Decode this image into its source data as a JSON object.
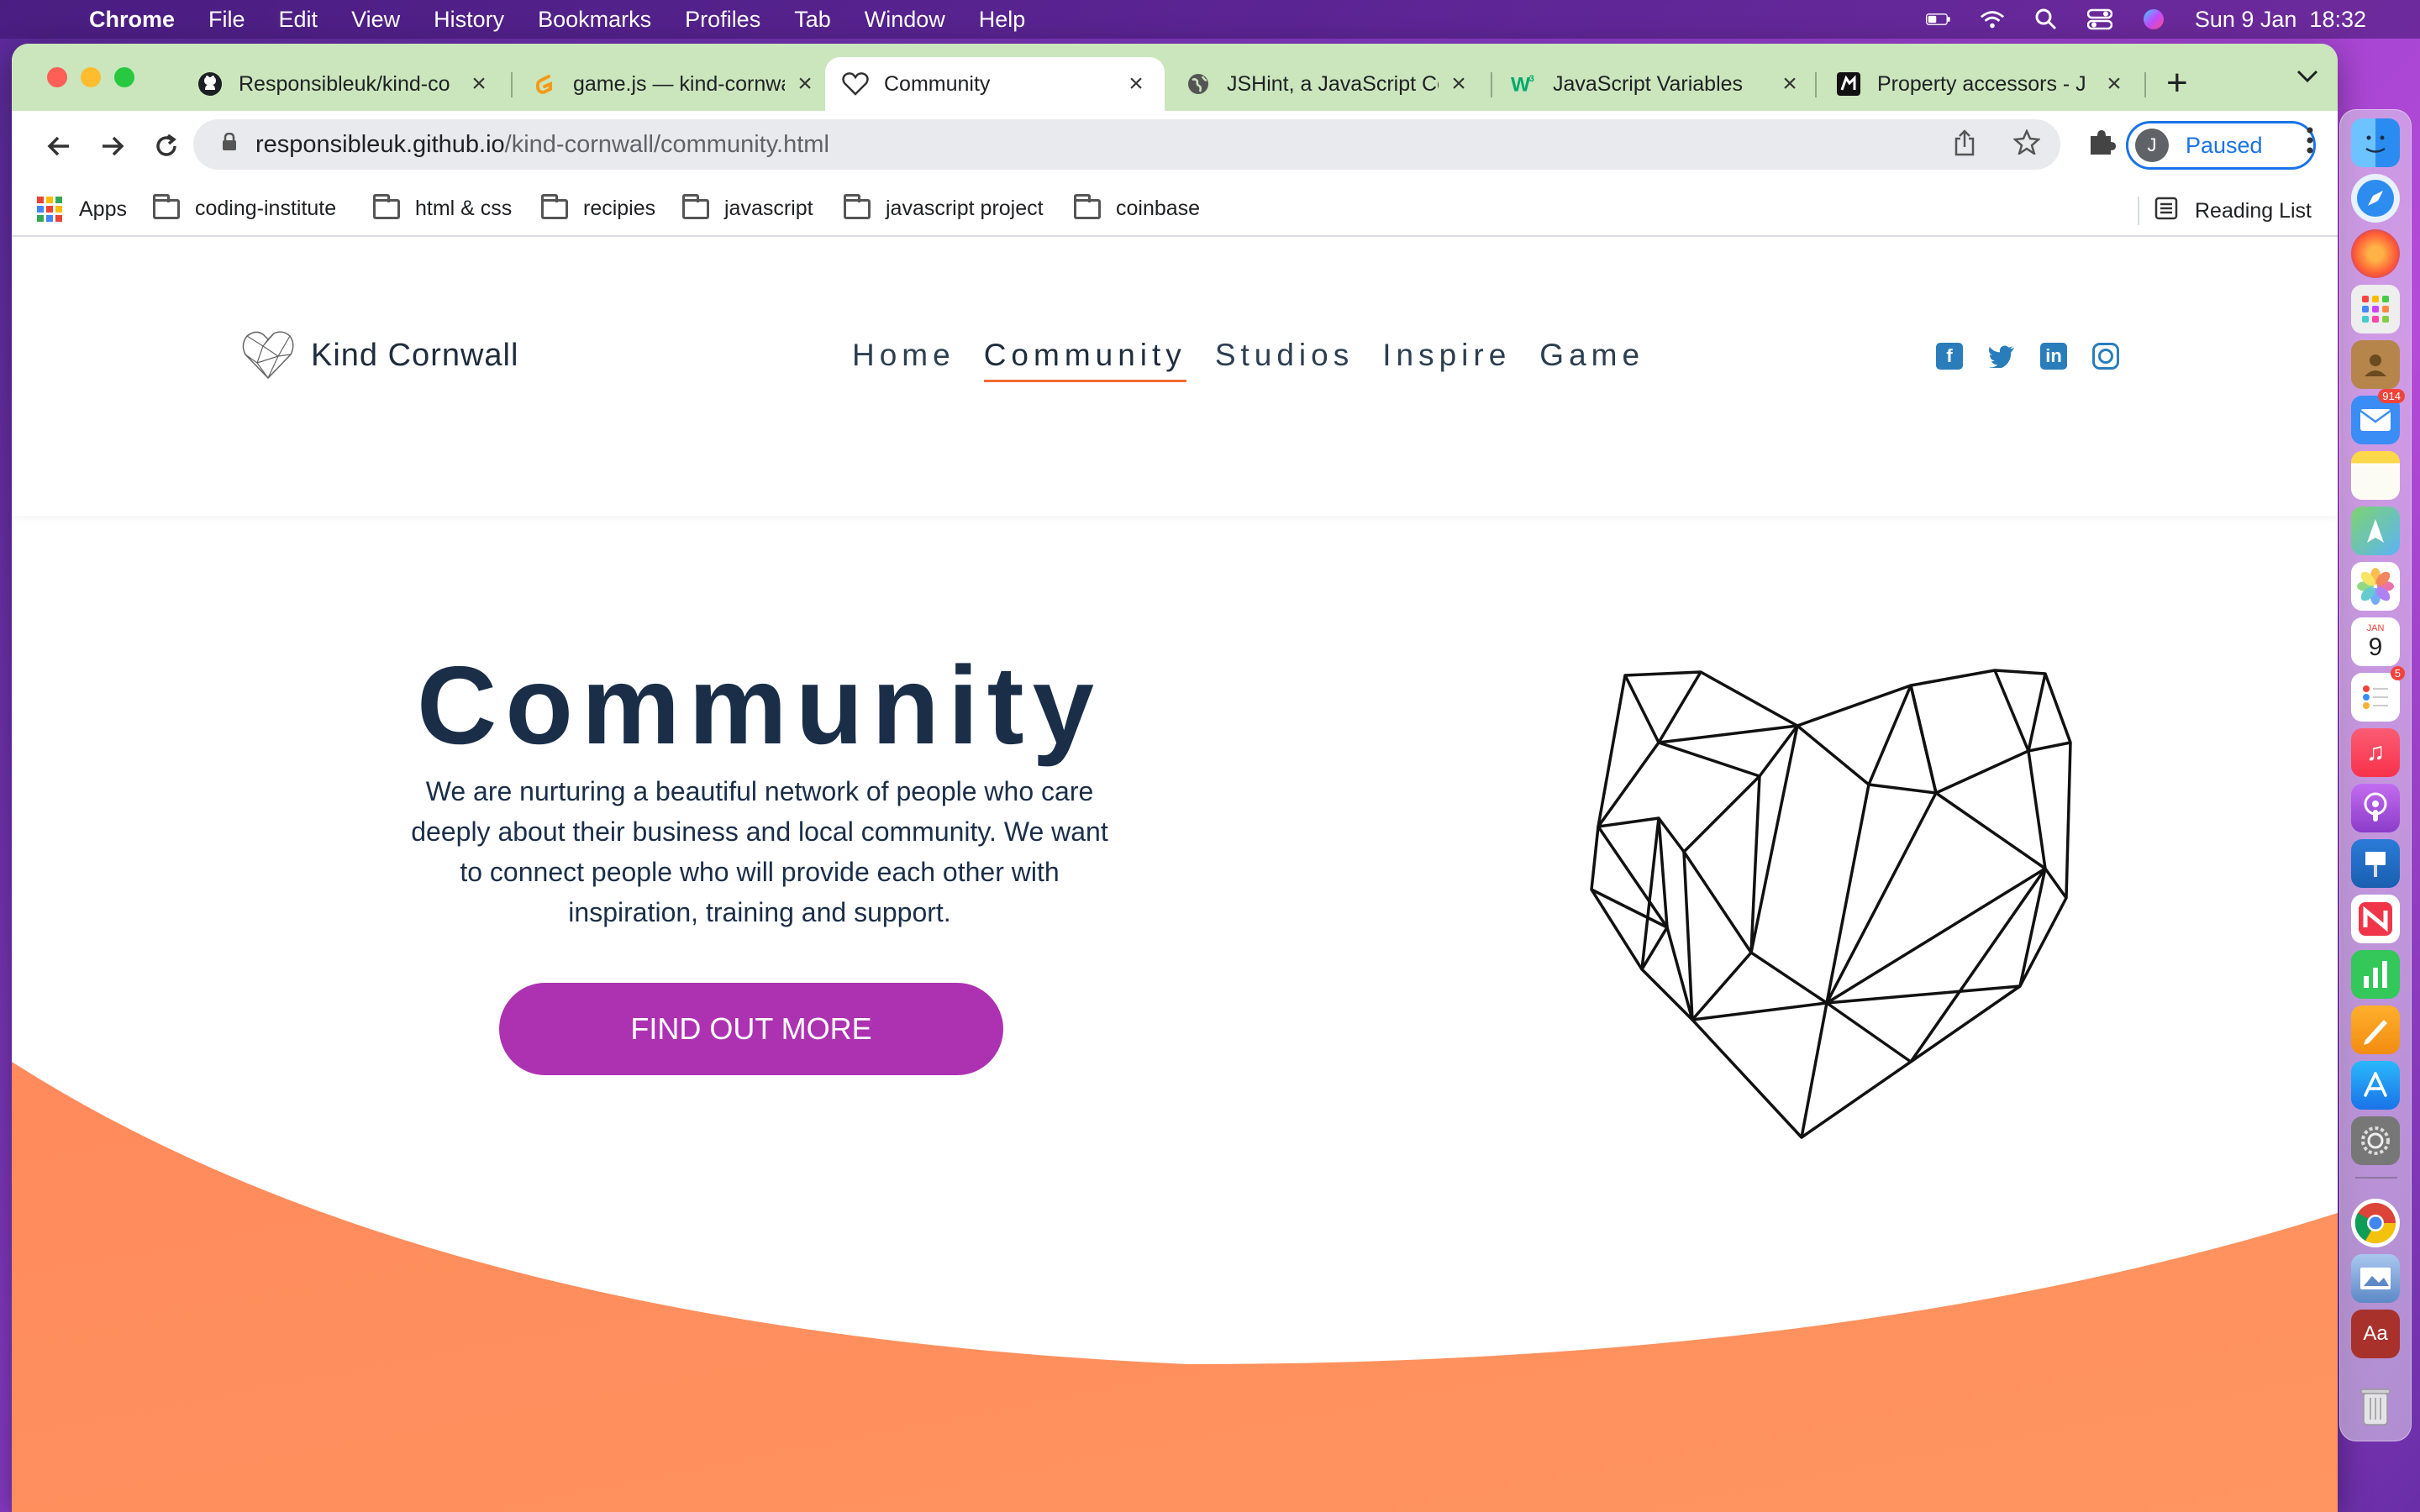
{
  "menubar": {
    "app_name": "Chrome",
    "items": [
      "File",
      "Edit",
      "View",
      "History",
      "Bookmarks",
      "Profiles",
      "Tab",
      "Window",
      "Help"
    ],
    "datetime": "Sun 9 Jan  18:32"
  },
  "browser": {
    "tabs": [
      {
        "title": "Responsibleuk/kind-co",
        "icon": "github-icon"
      },
      {
        "title": "game.js — kind-cornwa",
        "icon": "gitpod-icon"
      },
      {
        "title": "Community",
        "icon": "heart-icon",
        "active": true
      },
      {
        "title": "JSHint, a JavaScript Co",
        "icon": "globe-icon"
      },
      {
        "title": "JavaScript Variables",
        "icon": "w3schools-icon"
      },
      {
        "title": "Property accessors - J",
        "icon": "mdn-icon"
      }
    ],
    "url_host": "responsibleuk.github.io",
    "url_path": "/kind-cornwall/community.html",
    "profile_initial": "J",
    "profile_status": "Paused",
    "bookmarks": [
      "Apps",
      "coding-institute",
      "html & css",
      "recipies",
      "javascript",
      "javascript project",
      "coinbase"
    ],
    "reading_list": "Reading List"
  },
  "site": {
    "logo_text": "Kind Cornwall",
    "nav": [
      "Home",
      "Community",
      "Studios",
      "Inspire",
      "Game"
    ],
    "active_nav": "Community",
    "social": [
      "facebook-icon",
      "twitter-icon",
      "linkedin-icon",
      "instagram-icon"
    ],
    "social_color": "#2a7dbb",
    "hero": {
      "title": "Community",
      "text": "We are nurturing a beautiful network of people who care deeply about their business and local community. We want to connect people who will provide each other with inspiration, training and support.",
      "button": "FIND OUT MORE"
    },
    "colors": {
      "title": "#1b2e48",
      "button": "#ad32b2",
      "wave": "#ff8c5e",
      "nav_underline": "#f26b2f"
    }
  },
  "dock": {
    "mail_badge": "914",
    "reminders_badge": "5",
    "calendar_month": "JAN",
    "calendar_day": "9"
  }
}
